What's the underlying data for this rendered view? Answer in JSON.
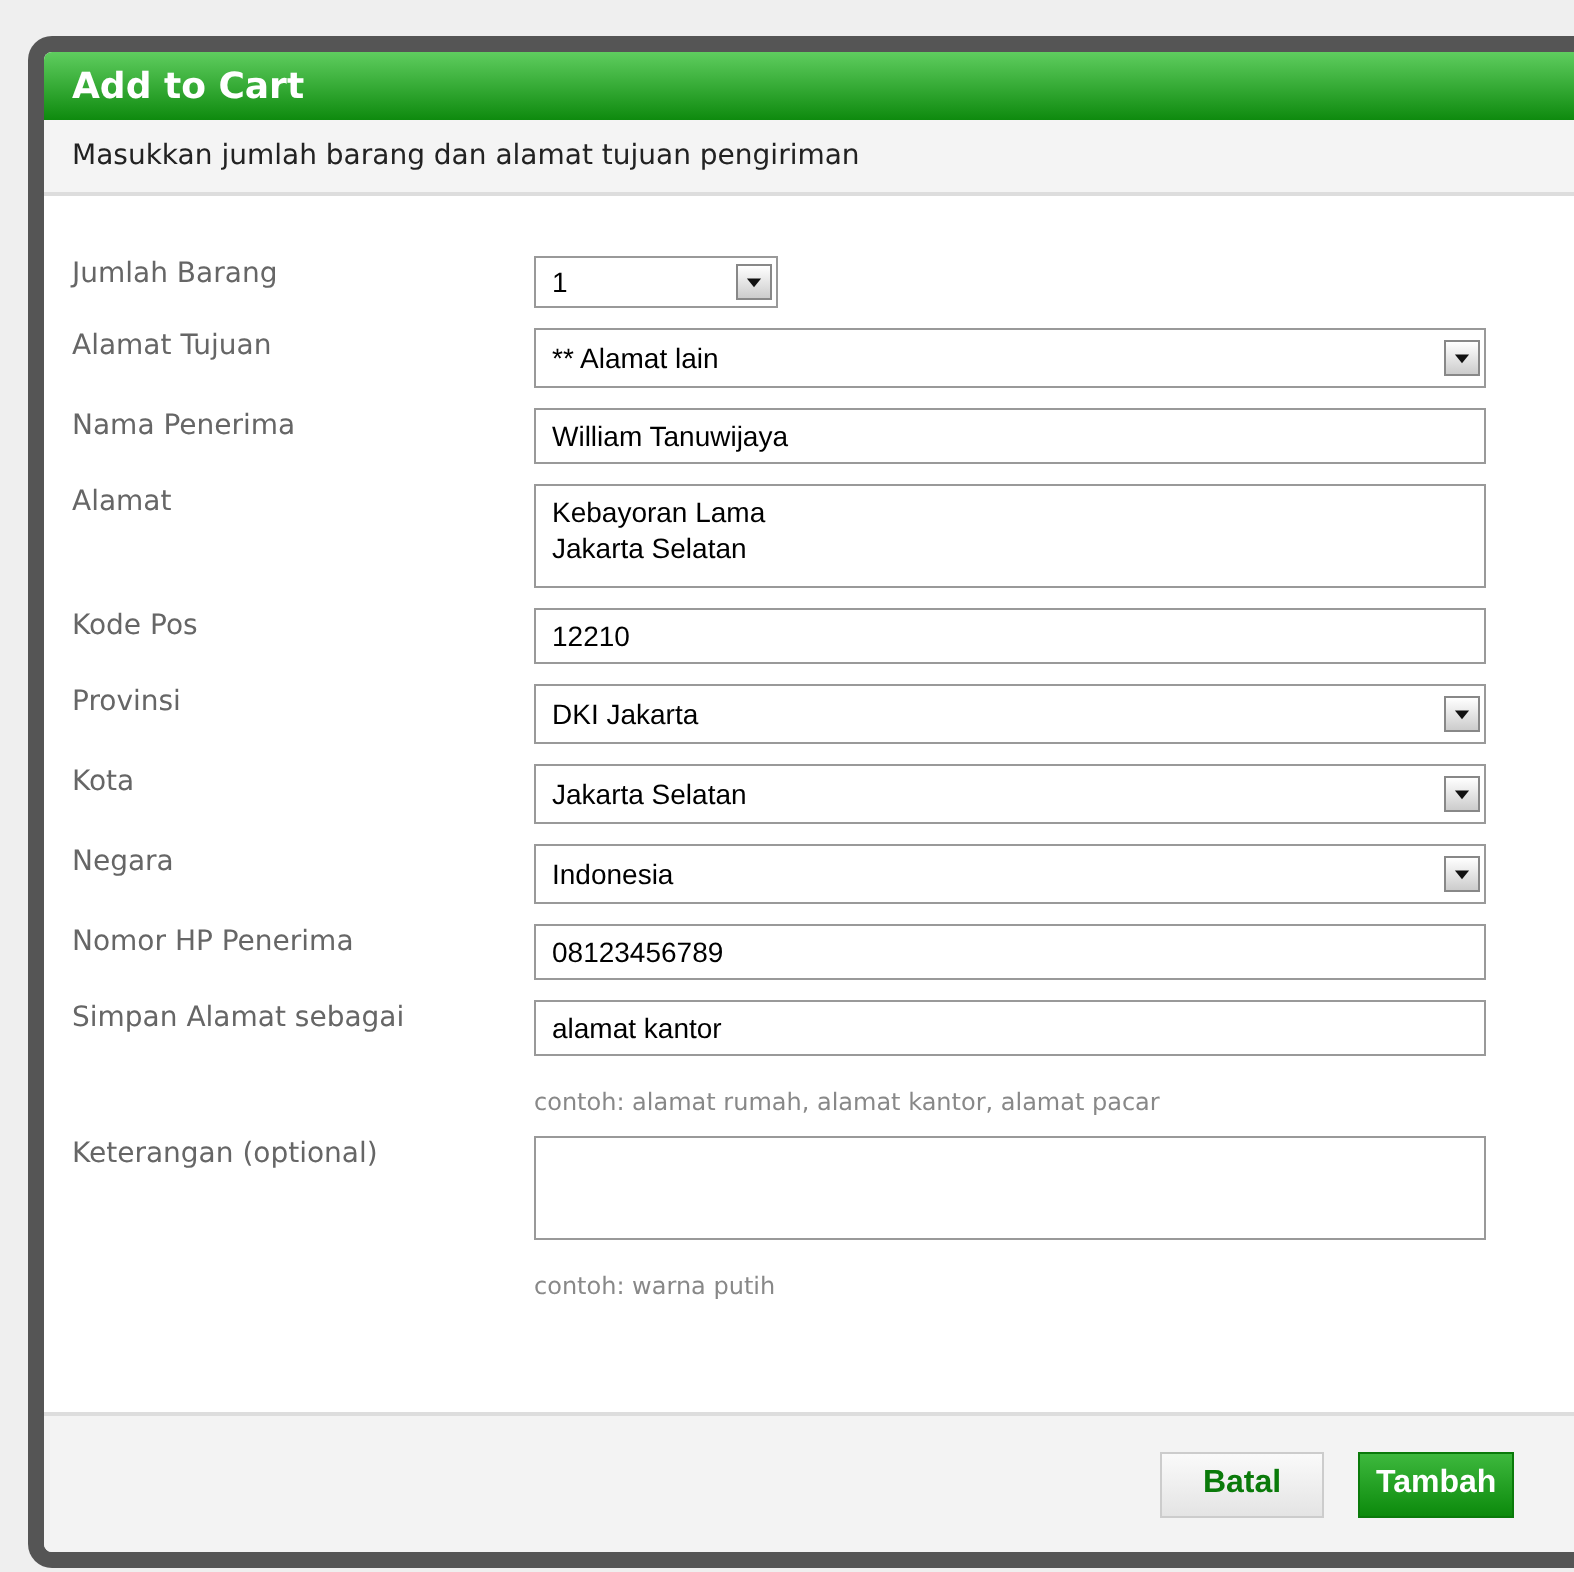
{
  "dialog": {
    "title": "Add to Cart",
    "subtitle": "Masukkan jumlah barang dan alamat tujuan pengiriman"
  },
  "fields": [
    {
      "label": "Jumlah Barang",
      "kind": "select",
      "value": "1",
      "short": true
    },
    {
      "label": "Alamat Tujuan",
      "kind": "select",
      "value": "** Alamat lain"
    },
    {
      "label": "Nama Penerima",
      "kind": "input",
      "value": "William Tanuwijaya"
    },
    {
      "label": "Alamat",
      "kind": "textarea",
      "value": "Kebayoran Lama\nJakarta Selatan"
    },
    {
      "label": "Kode Pos",
      "kind": "input",
      "value": "12210"
    },
    {
      "label": "Provinsi",
      "kind": "select",
      "value": "DKI Jakarta"
    },
    {
      "label": "Kota",
      "kind": "select",
      "value": "Jakarta Selatan"
    },
    {
      "label": "Negara",
      "kind": "select",
      "value": "Indonesia"
    },
    {
      "label": "Nomor HP Penerima",
      "kind": "input",
      "value": "08123456789"
    },
    {
      "label": "Simpan Alamat sebagai",
      "kind": "input",
      "value": "alamat kantor",
      "hint": "contoh: alamat rumah, alamat kantor, alamat pacar"
    },
    {
      "label": "Keterangan (optional)",
      "kind": "textarea",
      "hint": "contoh: warna putih"
    }
  ],
  "buttons": [
    {
      "label": "Batal",
      "kind": "secondary"
    },
    {
      "label": "Tambah",
      "kind": "primary"
    }
  ]
}
